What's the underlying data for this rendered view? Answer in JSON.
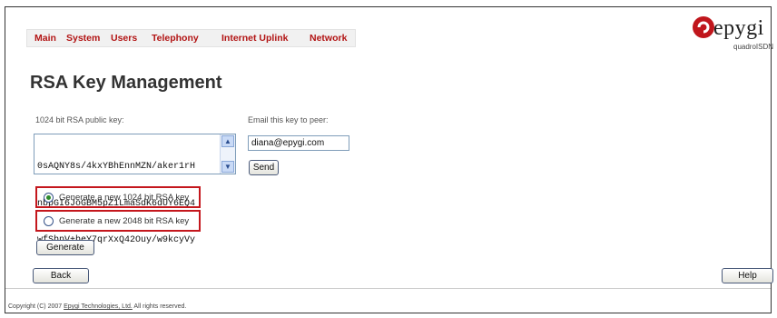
{
  "menu": {
    "items": [
      "Main",
      "System",
      "Users",
      "Telephony",
      "Internet Uplink",
      "Network"
    ]
  },
  "logo": {
    "brand": "epygi",
    "product": "quadroISDN"
  },
  "page_title": "RSA Key Management",
  "public_key": {
    "label": "1024 bit RSA public key:",
    "lines": [
      "0sAQNY8s/4kxYBhEnnMZN/aker1rH",
      "nbpGI6JoGBM5pZ1LmaSdK6dUY6EQ4",
      "wfSbpV+beY7qrXxQ42Ouy/w9kcyVy"
    ]
  },
  "email": {
    "label": "Email this key to peer:",
    "value": "diana@epygi.com",
    "send_label": "Send"
  },
  "options": {
    "opt1": "Generate a new 1024 bit RSA key",
    "opt2": "Generate a new 2048 bit RSA key",
    "selected": "opt1"
  },
  "buttons": {
    "generate": "Generate",
    "back": "Back",
    "help": "Help"
  },
  "footer": {
    "prefix": "Copyright (C) 2007 ",
    "company": "Epygi Technologies, Ltd.",
    "suffix": " All rights reserved."
  },
  "colors": {
    "menu_text": "#b21414",
    "highlight_border": "#c4171d",
    "logo_red": "#c0161c"
  }
}
